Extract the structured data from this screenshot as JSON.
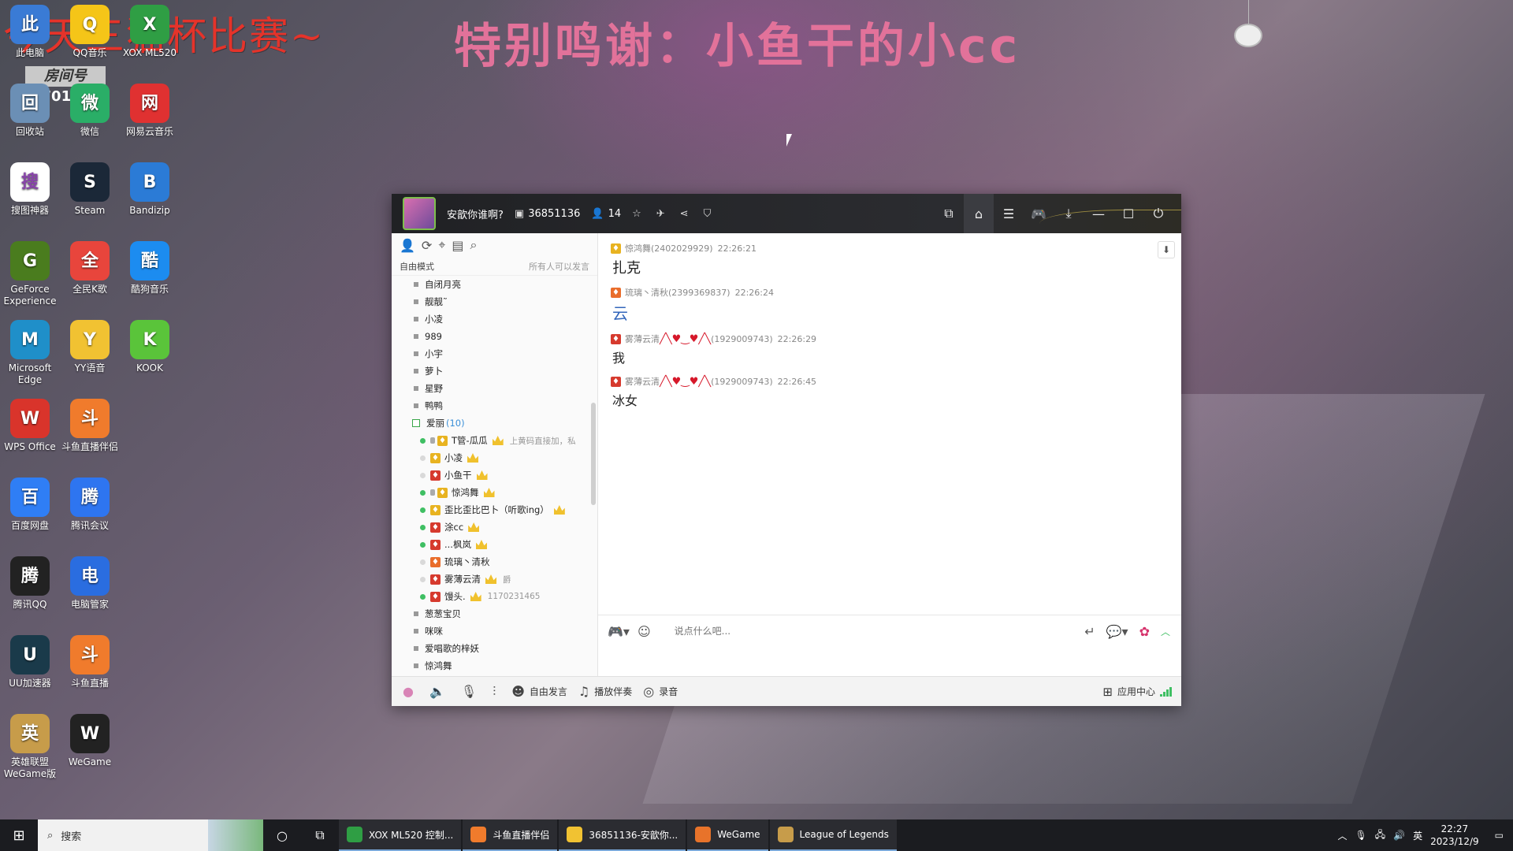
{
  "overlay": {
    "left_title": "今天三猫杯比赛~",
    "center_title": "特别鸣谢：小鱼干的小cc",
    "room_label": "房间号",
    "room_number": "97016?"
  },
  "desktop_icons": [
    {
      "label": "此电脑",
      "icon": "computer-icon",
      "color": "#3a7bd5"
    },
    {
      "label": "QQ音乐",
      "icon": "qq-music-icon",
      "color": "#f5c518"
    },
    {
      "label": "XOX ML520",
      "icon": "xox-icon",
      "color": "#2f9e44"
    },
    {
      "label": "回收站",
      "icon": "recycle-bin-icon",
      "color": "#6b8fb5"
    },
    {
      "label": "微信",
      "icon": "wechat-icon",
      "color": "#2aae67"
    },
    {
      "label": "网易云音乐",
      "icon": "netease-music-icon",
      "color": "#e03131"
    },
    {
      "label": "搜图神器",
      "icon": "image-search-icon",
      "color": "#ffffff"
    },
    {
      "label": "Steam",
      "icon": "steam-icon",
      "color": "#1b2838"
    },
    {
      "label": "Bandizip",
      "icon": "bandizip-icon",
      "color": "#2b7bd6"
    },
    {
      "label": "GeForce Experience",
      "icon": "geforce-icon",
      "color": "#4a7c1e"
    },
    {
      "label": "全民K歌",
      "icon": "karaoke-icon",
      "color": "#e8453c"
    },
    {
      "label": "酷狗音乐",
      "icon": "kugou-icon",
      "color": "#1c8cf0"
    },
    {
      "label": "Microsoft Edge",
      "icon": "edge-icon",
      "color": "#1f8fc9"
    },
    {
      "label": "YY语音",
      "icon": "yy-icon",
      "color": "#f1c232"
    },
    {
      "label": "KOOK",
      "icon": "kook-icon",
      "color": "#5ac43a"
    },
    {
      "label": "WPS Office",
      "icon": "wps-icon",
      "color": "#d9342b"
    },
    {
      "label": "斗鱼直播伴侣",
      "icon": "douyu-companion-icon",
      "color": "#f07b2c"
    },
    {
      "label": "百度网盘",
      "icon": "baidu-pan-icon",
      "color": "#2f7ef5"
    },
    {
      "label": "腾讯会议",
      "icon": "tencent-meeting-icon",
      "color": "#2e75f0"
    },
    {
      "label": "腾讯QQ",
      "icon": "qq-icon",
      "color": "#222222"
    },
    {
      "label": "电脑管家",
      "icon": "pc-manager-icon",
      "color": "#2a6de0"
    },
    {
      "label": "UU加速器",
      "icon": "uu-icon",
      "color": "#1a3a4a"
    },
    {
      "label": "斗鱼直播",
      "icon": "douyu-icon",
      "color": "#f07b2c"
    },
    {
      "label": "英雄联盟WeGame版",
      "icon": "lol-icon",
      "color": "#c79c4a"
    },
    {
      "label": "WeGame",
      "icon": "wegame-icon",
      "color": "#222222"
    }
  ],
  "window": {
    "title": "安歆你谁啊?",
    "room_id": "36851136",
    "online_count": "14",
    "mode_label": "自由模式",
    "mode_note": "所有人可以发言",
    "input_placeholder": "说点什么吧...",
    "bottom": {
      "free_speak": "自由发言",
      "play_accompaniment": "播放伴奏",
      "record": "录音",
      "app_center": "应用中心"
    }
  },
  "channels_top": [
    {
      "name": "自闭月亮"
    },
    {
      "name": "靓靓˜"
    },
    {
      "name": "小凌"
    },
    {
      "name": "989"
    },
    {
      "name": "小宇"
    },
    {
      "name": "萝卜"
    },
    {
      "name": "星野"
    },
    {
      "name": "鸭鸭"
    }
  ],
  "open_channel": {
    "name": "爱丽",
    "count": "(10)"
  },
  "members": [
    {
      "name": "T管-瓜瓜",
      "badge": "gold",
      "online": true,
      "mic": true,
      "crown": true,
      "extra": "上黄码直接加，私"
    },
    {
      "name": "小凌",
      "badge": "gold",
      "online": false,
      "mic": false,
      "crown": true,
      "extra": ""
    },
    {
      "name": "小鱼干",
      "badge": "red",
      "online": false,
      "mic": false,
      "crown": true,
      "extra": ""
    },
    {
      "name": "惊鸿舞",
      "badge": "gold",
      "online": true,
      "mic": true,
      "crown": true,
      "extra": ""
    },
    {
      "name": "歪比歪比巴卜（听歌ing）",
      "badge": "gold",
      "online": true,
      "mic": false,
      "crown": true,
      "extra": ""
    },
    {
      "name": "涂cc",
      "badge": "red",
      "online": true,
      "mic": false,
      "crown": true,
      "extra": ""
    },
    {
      "name": "...枫岚",
      "badge": "red",
      "online": true,
      "mic": false,
      "crown": true,
      "extra": ""
    },
    {
      "name": "琉璃丶清秋",
      "badge": "orange",
      "online": false,
      "mic": false,
      "crown": false,
      "extra": ""
    },
    {
      "name": "雾薄云清",
      "badge": "red",
      "online": false,
      "mic": false,
      "crown": true,
      "extra": "爵"
    },
    {
      "name": "馒头.",
      "badge": "red",
      "online": true,
      "mic": false,
      "crown": true,
      "extra": "1170231465"
    }
  ],
  "channels_bottom": [
    {
      "name": "葱葱宝贝"
    },
    {
      "name": "咪咪"
    },
    {
      "name": "爱唱歌的梓妖"
    },
    {
      "name": "惊鸿舞"
    }
  ],
  "messages": [
    {
      "sender": "惊鸿舞(2402029929)",
      "time": "22:26:21",
      "text": "扎克",
      "badge": "gold",
      "style": "normal"
    },
    {
      "sender": "琉璃丶清秋(2399369837)",
      "time": "22:26:24",
      "text": "云",
      "badge": "orange",
      "style": "cloud"
    },
    {
      "sender": "雾薄云清",
      "sender_suffix": "(1929009743)",
      "time": "22:26:29",
      "text": "我",
      "badge": "red",
      "style": "small"
    },
    {
      "sender": "雾薄云清",
      "sender_suffix": "(1929009743)",
      "time": "22:26:45",
      "text": "冰女",
      "badge": "red",
      "style": "small"
    }
  ],
  "taskbar": {
    "search_placeholder": "搜索",
    "apps": [
      {
        "label": "XOX ML520 控制...",
        "color": "#2f9e44"
      },
      {
        "label": "斗鱼直播伴侣",
        "color": "#f07b2c"
      },
      {
        "label": "36851136-安歆你...",
        "color": "#f1c232"
      },
      {
        "label": "WeGame",
        "color": "#e8732a"
      },
      {
        "label": "League of Legends",
        "color": "#c79c4a"
      }
    ],
    "ime": "英",
    "time": "22:27",
    "date": "2023/12/9"
  }
}
